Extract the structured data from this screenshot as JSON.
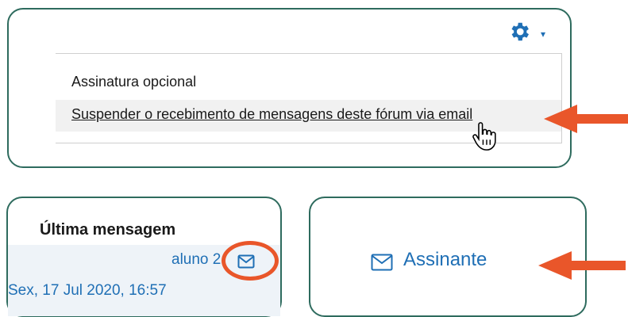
{
  "forum_settings": {
    "gear_icon": "gear-icon",
    "caret_icon": "caret-down-icon",
    "menu": {
      "items": [
        {
          "label": "Assinatura opcional"
        },
        {
          "label": "Suspender o recebimento de mensagens deste fórum via email"
        }
      ]
    }
  },
  "last_message": {
    "header": "Última mensagem",
    "author": "aluno 2",
    "date": "Sex, 17 Jul 2020, 16:57"
  },
  "subscription": {
    "label": "Assinante"
  },
  "colors": {
    "accent_blue": "#1f6fb5",
    "border_green": "#2e6b5e",
    "annotation_orange": "#e9562a"
  }
}
